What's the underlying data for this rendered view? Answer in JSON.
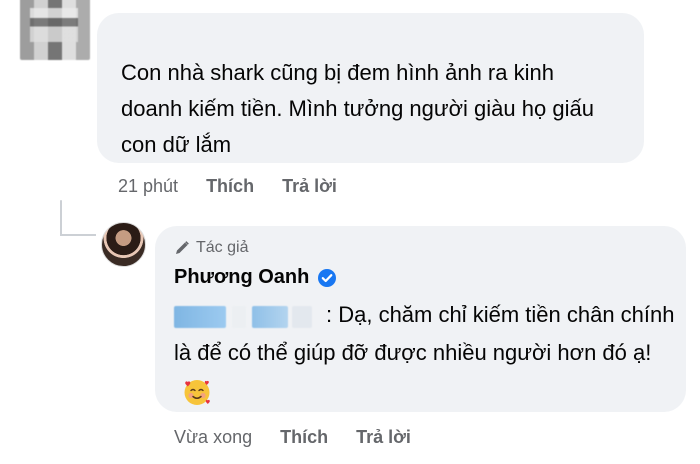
{
  "comments": [
    {
      "text": "Con nhà shark cũng bị đem hình ảnh ra kinh doanh kiếm tiền. Mình tưởng người giàu họ giấu con dữ lắm",
      "time": "21 phút",
      "like_label": "Thích",
      "reply_label": "Trả lời"
    }
  ],
  "reply": {
    "badge_label": "Tác giả",
    "author_name": "Phương Oanh",
    "text": ": Dạ, chăm chỉ kiếm tiền chân chính là để có thể giúp đỡ được nhiều người hơn đó ạ!",
    "emoji": "smiling-face-with-hearts-icon",
    "time": "Vừa xong",
    "like_label": "Thích",
    "reply_label": "Trả lời"
  },
  "colors": {
    "bubble_bg": "#f0f2f5",
    "meta_text": "#65676b",
    "verified_blue": "#1877f2"
  }
}
